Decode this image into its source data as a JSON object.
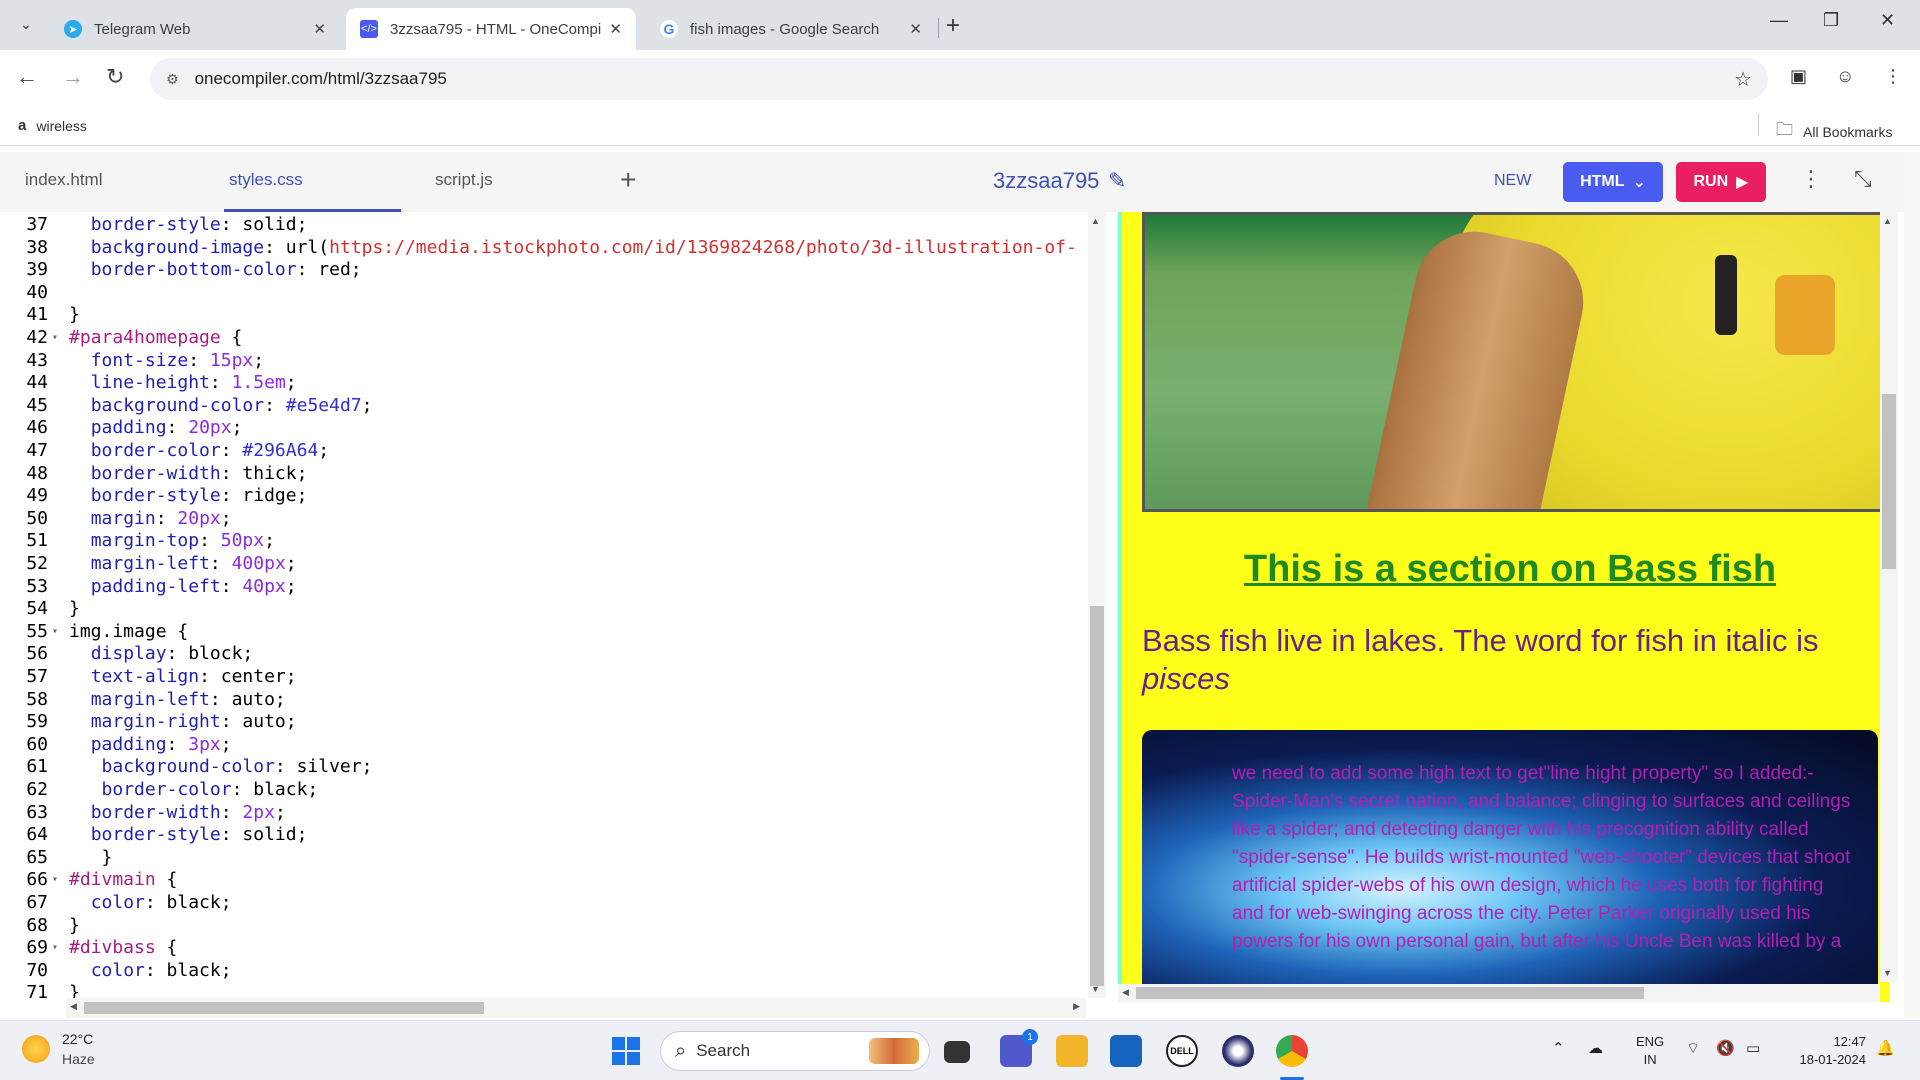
{
  "browser": {
    "tabs": [
      {
        "title": "Telegram Web",
        "active": false
      },
      {
        "title": "3zzsaa795 - HTML - OneCompi",
        "active": true
      },
      {
        "title": "fish images - Google Search",
        "active": false
      }
    ],
    "url": "onecompiler.com/html/3zzsaa795",
    "bookmarks": {
      "left_item": "wireless",
      "right_item": "All Bookmarks"
    }
  },
  "onecompiler": {
    "files": [
      "index.html",
      "styles.css",
      "script.js"
    ],
    "active_file": "styles.css",
    "project_name": "3zzsaa795",
    "new_label": "NEW",
    "language_label": "HTML",
    "run_label": "RUN"
  },
  "editor": {
    "lines": [
      {
        "n": "37",
        "fold": "",
        "text": "  border-style: solid;"
      },
      {
        "n": "38",
        "fold": "",
        "text": "  background-image: url(https://media.istockphoto.com/id/1369824268/photo/3d-illustration-of-"
      },
      {
        "n": "39",
        "fold": "",
        "text": "  border-bottom-color: red;"
      },
      {
        "n": "40",
        "fold": "",
        "text": ""
      },
      {
        "n": "41",
        "fold": "",
        "text": "}"
      },
      {
        "n": "42",
        "fold": "▾",
        "text": "#para4homepage {"
      },
      {
        "n": "43",
        "fold": "",
        "text": "  font-size: 15px;"
      },
      {
        "n": "44",
        "fold": "",
        "text": "  line-height: 1.5em;"
      },
      {
        "n": "45",
        "fold": "",
        "text": "  background-color: #e5e4d7;"
      },
      {
        "n": "46",
        "fold": "",
        "text": "  padding: 20px;"
      },
      {
        "n": "47",
        "fold": "",
        "text": "  border-color: #296A64;"
      },
      {
        "n": "48",
        "fold": "",
        "text": "  border-width: thick;"
      },
      {
        "n": "49",
        "fold": "",
        "text": "  border-style: ridge;"
      },
      {
        "n": "50",
        "fold": "",
        "text": "  margin: 20px;"
      },
      {
        "n": "51",
        "fold": "",
        "text": "  margin-top: 50px;"
      },
      {
        "n": "52",
        "fold": "",
        "text": "  margin-left: 400px;"
      },
      {
        "n": "53",
        "fold": "",
        "text": "  padding-left: 40px;"
      },
      {
        "n": "54",
        "fold": "",
        "text": "}"
      },
      {
        "n": "55",
        "fold": "▾",
        "text": "img.image {"
      },
      {
        "n": "56",
        "fold": "",
        "text": "  display: block;"
      },
      {
        "n": "57",
        "fold": "",
        "text": "  text-align: center;"
      },
      {
        "n": "58",
        "fold": "",
        "text": "  margin-left: auto;"
      },
      {
        "n": "59",
        "fold": "",
        "text": "  margin-right: auto;"
      },
      {
        "n": "60",
        "fold": "",
        "text": "  padding: 3px;"
      },
      {
        "n": "61",
        "fold": "",
        "text": "   background-color: silver;"
      },
      {
        "n": "62",
        "fold": "",
        "text": "   border-color: black;"
      },
      {
        "n": "63",
        "fold": "",
        "text": "  border-width: 2px;"
      },
      {
        "n": "64",
        "fold": "",
        "text": "  border-style: solid;"
      },
      {
        "n": "65",
        "fold": "",
        "text": "   }"
      },
      {
        "n": "66",
        "fold": "▾",
        "text": "#divmain {"
      },
      {
        "n": "67",
        "fold": "",
        "text": "  color: black;"
      },
      {
        "n": "68",
        "fold": "",
        "text": "}"
      },
      {
        "n": "69",
        "fold": "▾",
        "text": "#divbass {"
      },
      {
        "n": "70",
        "fold": "",
        "text": "  color: black;"
      },
      {
        "n": "71",
        "fold": "",
        "text": "}"
      }
    ]
  },
  "preview": {
    "bass_heading": "This is a section on Bass fish",
    "bass_para_prefix": "Bass fish live in lakes. The word for fish in italic is ",
    "bass_para_italic": "pisces",
    "cyber_text": "we need to add some high text to get\"line hight property\" so I added:-Spider-Man's secret nation, and balance; clinging to surfaces and ceilings like a spider; and detecting danger with his precognition ability called \"spider-sense\". He builds wrist-mounted \"web-shooter\" devices that shoot artificial spider-webs of his own design, which he uses both for fighting and for web-swinging across the city. Peter Parker originally used his powers for his own personal gain, but after his Uncle Ben was killed by a"
  },
  "taskbar": {
    "weather_temp": "22°C",
    "weather_cond": "Haze",
    "search_label": "Search",
    "chat_badge": "1",
    "lang_top": "ENG",
    "lang_bottom": "IN",
    "time": "12:47",
    "date": "18-01-2024"
  },
  "colors": {
    "accent": "#3f51b5",
    "run_button": "#e91e63",
    "html_button": "#4a5cf0",
    "preview_bg": "#ffff1a",
    "heading_green": "#1f8a1f",
    "para_purple": "#6b1f8a"
  }
}
